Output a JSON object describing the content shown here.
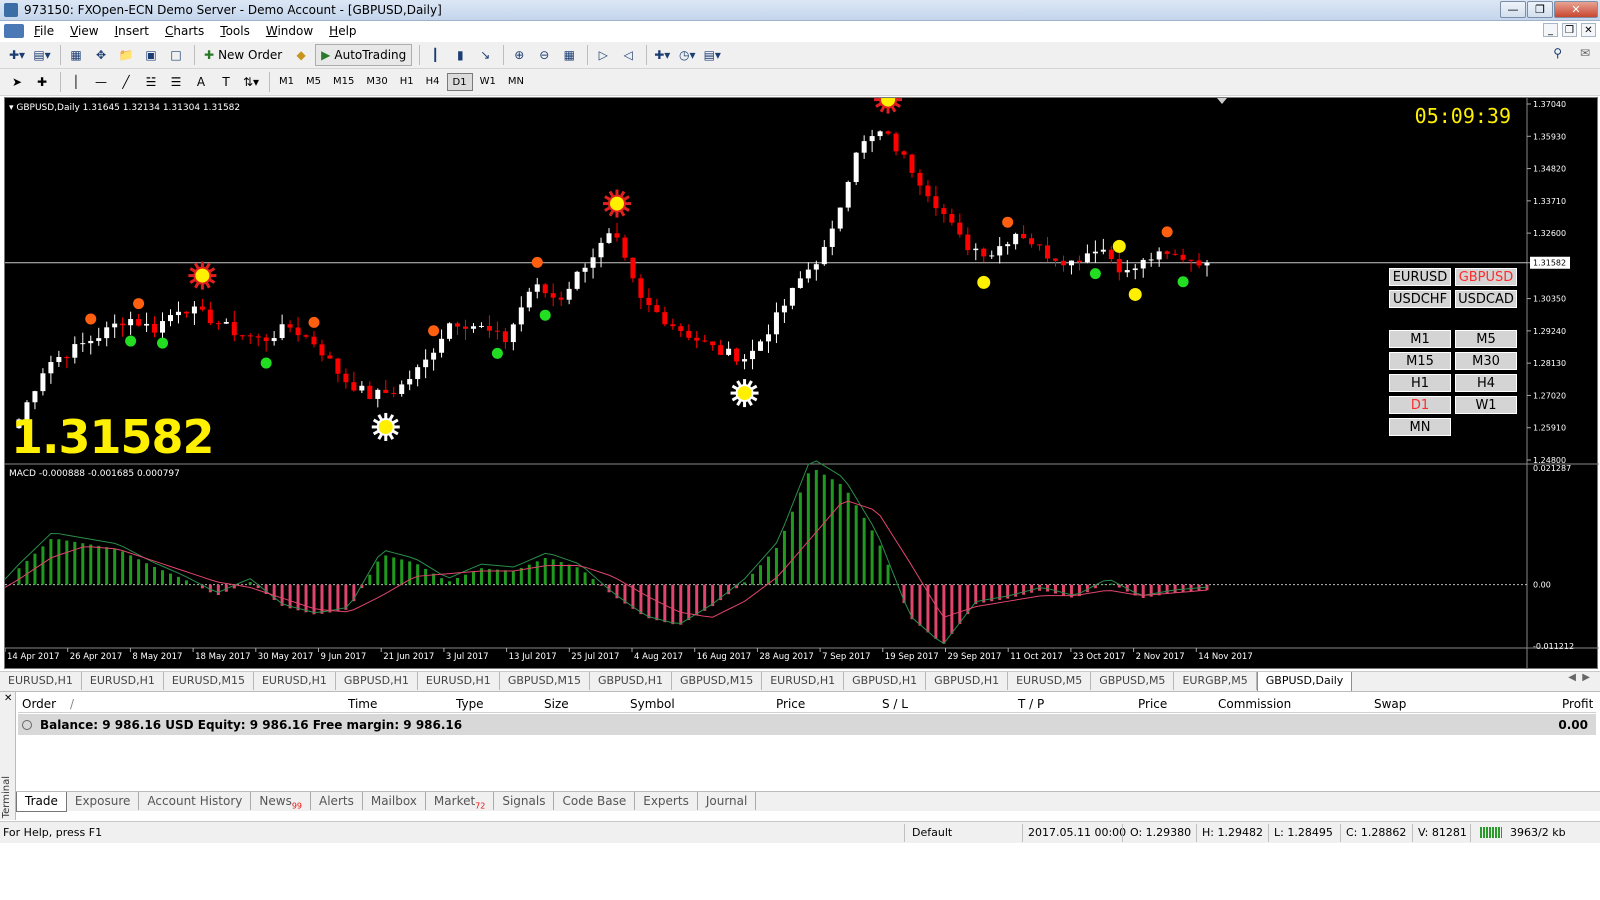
{
  "window": {
    "title": "973150: FXOpen-ECN Demo Server - Demo Account - [GBPUSD,Daily]"
  },
  "menu": [
    "File",
    "View",
    "Insert",
    "Charts",
    "Tools",
    "Window",
    "Help"
  ],
  "toolbar": {
    "new_order": "New Order",
    "autotrading": "AutoTrading"
  },
  "timeframes": [
    "M1",
    "M5",
    "M15",
    "M30",
    "H1",
    "H4",
    "D1",
    "W1",
    "MN"
  ],
  "active_timeframe": "D1",
  "chart": {
    "header": "GBPUSD,Daily  1.31645 1.32134 1.31304 1.31582",
    "macd_header": "MACD -0.000888 -0.001685 0.000797",
    "current_price": "1.31582",
    "clock": "05:09:39",
    "colors": {
      "bull": "#ffffff",
      "bear": "#ff0000",
      "macd_pos": "#1f9a1f",
      "macd_neg": "#e0456d",
      "signal": "#e0456d",
      "main": "#2a8f4a",
      "label": "#ffef00"
    }
  },
  "chart_data": {
    "type": "candlestick",
    "price_axis_ticks": [
      "1.37040",
      "1.35930",
      "1.34820",
      "1.33710",
      "1.32600",
      "1.31582",
      "1.30350",
      "1.29240",
      "1.28130",
      "1.27020",
      "1.25910",
      "1.24800"
    ],
    "price_range": [
      1.248,
      1.3704
    ],
    "macd_axis_ticks": [
      "0.021287",
      "0.00",
      "-0.011212"
    ],
    "macd_range": [
      -0.0112,
      0.0213
    ],
    "date_labels": [
      "14 Apr 2017",
      "26 Apr 2017",
      "8 May 2017",
      "18 May 2017",
      "30 May 2017",
      "9 Jun 2017",
      "21 Jun 2017",
      "3 Jul 2017",
      "13 Jul 2017",
      "25 Jul 2017",
      "4 Aug 2017",
      "16 Aug 2017",
      "28 Aug 2017",
      "7 Sep 2017",
      "19 Sep 2017",
      "29 Sep 2017",
      "11 Oct 2017",
      "23 Oct 2017",
      "2 Nov 2017",
      "14 Nov 2017"
    ],
    "close_anchors": [
      1.262,
      1.281,
      1.286,
      1.291,
      1.297,
      1.293,
      1.301,
      1.297,
      1.292,
      1.289,
      1.294,
      1.288,
      1.276,
      1.27,
      1.272,
      1.281,
      1.296,
      1.294,
      1.289,
      1.308,
      1.303,
      1.316,
      1.326,
      1.303,
      1.296,
      1.29,
      1.285,
      1.283,
      1.296,
      1.311,
      1.322,
      1.355,
      1.361,
      1.349,
      1.336,
      1.322,
      1.319,
      1.327,
      1.319,
      1.316,
      1.322,
      1.312,
      1.318,
      1.318,
      1.316
    ],
    "macd_main_anchors": [
      0.003,
      0.0085,
      0.0075,
      0.0065,
      0.0035,
      0.001,
      -0.002,
      0.0005,
      -0.004,
      -0.0055,
      -0.0045,
      0.0055,
      0.004,
      0.0005,
      0.003,
      0.0025,
      0.005,
      0.003,
      -0.002,
      -0.006,
      -0.0075,
      -0.004,
      0.0005,
      0.007,
      0.0215,
      0.018,
      0.0085,
      -0.006,
      -0.011,
      -0.0035,
      -0.0025,
      -0.001,
      -0.0025,
      0.0005,
      -0.0025,
      -0.0015,
      -0.001
    ],
    "macd_signal_anchors": [
      0.001,
      0.005,
      0.007,
      0.0065,
      0.0045,
      0.0025,
      0.0005,
      -0.0005,
      -0.0025,
      -0.0045,
      -0.005,
      -0.002,
      0.0015,
      0.002,
      0.0025,
      0.0025,
      0.0035,
      0.0035,
      0.0015,
      -0.002,
      -0.005,
      -0.006,
      -0.003,
      0.0015,
      0.0085,
      0.0155,
      0.0135,
      0.004,
      -0.006,
      -0.004,
      -0.003,
      -0.002,
      -0.002,
      -0.001,
      -0.002,
      -0.0015,
      -0.001
    ],
    "signals": [
      {
        "kind": "top-big",
        "day": 15
      },
      {
        "kind": "bottom-big",
        "day": 30
      },
      {
        "kind": "top-big",
        "day": 49
      },
      {
        "kind": "bottom-big",
        "day": 59
      },
      {
        "kind": "top-big",
        "day": 71
      },
      {
        "kind": "top",
        "day": 6
      },
      {
        "kind": "top",
        "day": 10
      },
      {
        "kind": "top",
        "day": 24
      },
      {
        "kind": "top",
        "day": 34
      },
      {
        "kind": "top",
        "day": 42
      },
      {
        "kind": "top",
        "day": 81
      },
      {
        "kind": "top",
        "day": 94
      },
      {
        "kind": "bottom",
        "day": 9
      },
      {
        "kind": "bottom",
        "day": 12
      },
      {
        "kind": "bottom",
        "day": 20
      },
      {
        "kind": "bottom",
        "day": 39
      },
      {
        "kind": "bottom",
        "day": 43
      },
      {
        "kind": "bottom",
        "day": 88
      },
      {
        "kind": "bottom",
        "day": 95
      },
      {
        "kind": "ytop",
        "day": 90
      },
      {
        "kind": "ybot",
        "day": 79
      },
      {
        "kind": "ybot",
        "day": 91
      }
    ]
  },
  "symbol_buttons": [
    "EURUSD",
    "GBPUSD",
    "USDCHF",
    "USDCAD"
  ],
  "active_symbol": "GBPUSD",
  "tf_buttons": [
    "M1",
    "M5",
    "M15",
    "M30",
    "H1",
    "H4",
    "D1",
    "W1",
    "MN"
  ],
  "chart_tabs": [
    "EURUSD,H1",
    "EURUSD,H1",
    "EURUSD,M15",
    "EURUSD,H1",
    "GBPUSD,H1",
    "EURUSD,H1",
    "GBPUSD,M15",
    "GBPUSD,H1",
    "GBPUSD,M15",
    "EURUSD,H1",
    "GBPUSD,H1",
    "GBPUSD,H1",
    "EURUSD,M5",
    "GBPUSD,M5",
    "EURGBP,M5",
    "GBPUSD,Daily"
  ],
  "active_chart_tab": "GBPUSD,Daily",
  "terminal": {
    "label": "Terminal",
    "columns": [
      "Order",
      "Time",
      "Type",
      "Size",
      "Symbol",
      "Price",
      "S / L",
      "T / P",
      "Price",
      "Commission",
      "Swap",
      "Profit"
    ],
    "balance_line": "Balance: 9 986.16 USD  Equity: 9 986.16  Free margin: 9 986.16",
    "profit": "0.00",
    "tabs": [
      "Trade",
      "Exposure",
      "Account History",
      "News",
      "Alerts",
      "Mailbox",
      "Market",
      "Signals",
      "Code Base",
      "Experts",
      "Journal"
    ],
    "news_count": "99",
    "market_count": "72"
  },
  "status": {
    "help": "For Help, press F1",
    "profile": "Default",
    "datetime": "2017.05.11 00:00",
    "open": "O: 1.29380",
    "high": "H: 1.29482",
    "low": "L: 1.28495",
    "close": "C: 1.28862",
    "volume": "V: 81281",
    "traffic": "3963/2 kb"
  }
}
